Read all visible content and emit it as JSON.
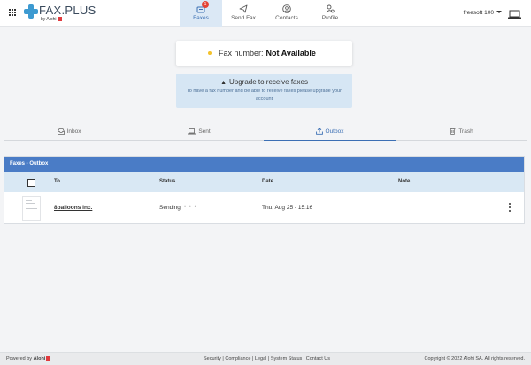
{
  "header": {
    "logo_text": "FAX.PLUS",
    "logo_by": "by Alohi",
    "nav": [
      {
        "label": "Faxes",
        "badge": "1",
        "active": true
      },
      {
        "label": "Send Fax"
      },
      {
        "label": "Contacts"
      },
      {
        "label": "Profile"
      }
    ],
    "user": "freesoft 100"
  },
  "fax_number": {
    "label": "Fax number:",
    "value": "Not Available"
  },
  "upgrade": {
    "title": "Upgrade to receive faxes",
    "description": "To have a fax number and be able to receive faxes please upgrade your account"
  },
  "tabs": [
    {
      "label": "Inbox",
      "icon": "inbox-icon"
    },
    {
      "label": "Sent",
      "icon": "sent-icon"
    },
    {
      "label": "Outbox",
      "icon": "outbox-icon",
      "active": true
    },
    {
      "label": "Trash",
      "icon": "trash-icon"
    }
  ],
  "table": {
    "title": "Faxes - Outbox",
    "columns": [
      "To",
      "Status",
      "Date",
      "Note"
    ],
    "rows": [
      {
        "to": "8balloons inc.",
        "status": "Sending",
        "date": "Thu, Aug 25 - 15:16",
        "note": ""
      }
    ]
  },
  "footer": {
    "powered_by": "Powered by",
    "brand": "Alohi",
    "links": "Security | Compliance | Legal | System Status | Contact Us",
    "copyright": "Copyright © 2022 Alohi SA. All rights reserved."
  },
  "colors": {
    "accent": "#3b6fb4",
    "table_header": "#4a7cc6",
    "nav_active_bg": "#dbe8f5",
    "badge": "#e34234"
  }
}
